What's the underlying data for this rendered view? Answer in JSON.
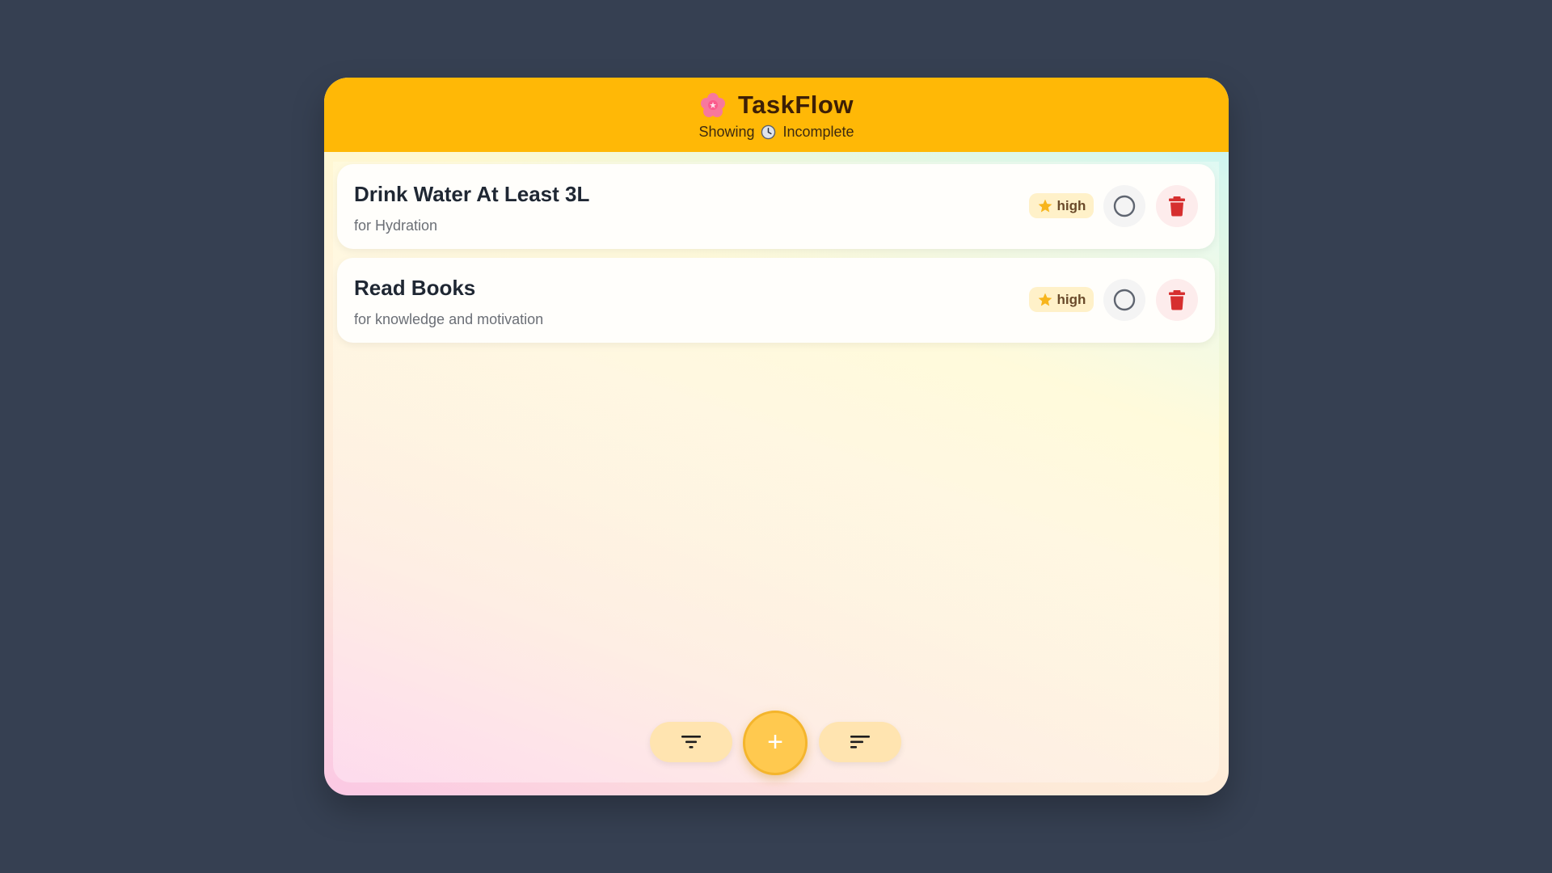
{
  "header": {
    "title": "TaskFlow",
    "logo_icon": "flower-icon",
    "showing_label": "Showing",
    "filter_icon": "clock-icon",
    "filter_value": "Incomplete",
    "background_color": "#ffb806"
  },
  "tasks": [
    {
      "title": "Drink Water At Least 3L",
      "description": "for Hydration",
      "priority": "high",
      "completed": false
    },
    {
      "title": "Read Books",
      "description": "for knowledge and motivation",
      "priority": "high",
      "completed": false
    }
  ],
  "toolbar": {
    "filter_icon": "filter-icon",
    "add_label": "+",
    "sort_icon": "sort-icon"
  },
  "colors": {
    "page_background": "#364052",
    "accent": "#ffb806",
    "delete": "#d62f2f",
    "priority_star": "#f7b51c"
  }
}
